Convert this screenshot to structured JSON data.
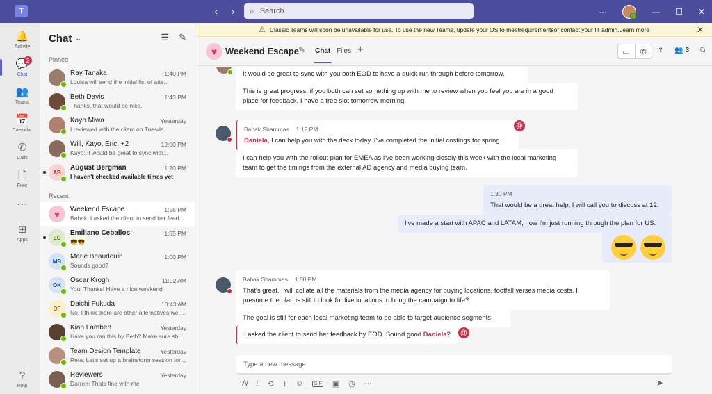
{
  "titlebar": {
    "search_placeholder": "Search",
    "more": "···",
    "minimize": "—",
    "maximize": "☐",
    "close": "✕"
  },
  "rail": {
    "items": [
      {
        "label": "Activity",
        "icon": "bell-icon",
        "glyph": "🔔"
      },
      {
        "label": "Chat",
        "icon": "chat-icon",
        "glyph": "💬",
        "badge": "2"
      },
      {
        "label": "Teams",
        "icon": "teams-icon",
        "glyph": "👥"
      },
      {
        "label": "Calendar",
        "icon": "calendar-icon",
        "glyph": "📅"
      },
      {
        "label": "Calls",
        "icon": "phone-icon",
        "glyph": "✆"
      },
      {
        "label": "Files",
        "icon": "file-icon",
        "glyph": "🗋"
      },
      {
        "label": "Apps",
        "icon": "apps-icon",
        "glyph": "⊞"
      },
      {
        "label": "Help",
        "icon": "help-icon",
        "glyph": "?"
      }
    ],
    "more": "···"
  },
  "chatlist": {
    "title": "Chat",
    "pinned_label": "Pinned",
    "recent_label": "Recent",
    "pinned": [
      {
        "name": "Ray Tanaka",
        "time": "1:40 PM",
        "preview": "Louisa will send the initial list of atte...",
        "avatar_color": "#9b7b6a",
        "initials": ""
      },
      {
        "name": "Beth Davis",
        "time": "1:43 PM",
        "preview": "Thanks, that would be nice.",
        "avatar_color": "#6a4a3a",
        "initials": ""
      },
      {
        "name": "Kayo Miwa",
        "time": "Yesterday",
        "preview": "I reviewed with the client on Tuesda...",
        "avatar_color": "#b08070",
        "initials": ""
      },
      {
        "name": "Will, Kayo, Eric, +2",
        "time": "12:00 PM",
        "preview": "Kayo: It would be great to sync with...",
        "avatar_color": "#8a6a5a",
        "initials": ""
      },
      {
        "name": "August Bergman",
        "time": "1:20 PM",
        "preview": "I haven't checked available times yet",
        "avatar_color": "#f6d5d5",
        "initials": "AB",
        "initials_color": "#a4262c",
        "bold": true
      }
    ],
    "recent": [
      {
        "name": "Weekend Escape",
        "time": "1:58 PM",
        "preview": "Babak: I asked the client to send her feed...",
        "avatar_color": "#f6c7d6",
        "initials": "♥",
        "initials_color": "#e3346c",
        "selected": true,
        "nostatus": true
      },
      {
        "name": "Emiliano Ceballos",
        "time": "1:55 PM",
        "preview": "😎😎",
        "avatar_color": "#dfe8d0",
        "initials": "EC",
        "initials_color": "#498205",
        "bold": true
      },
      {
        "name": "Marie Beaudouin",
        "time": "1:00 PM",
        "preview": "Sounds good?",
        "avatar_color": "#d6e3f4",
        "initials": "MB",
        "initials_color": "#0f548c"
      },
      {
        "name": "Oscar Krogh",
        "time": "11:02 AM",
        "preview": "You: Thanks! Have a nice weekend",
        "avatar_color": "#d6e3f4",
        "initials": "OK",
        "initials_color": "#0f548c"
      },
      {
        "name": "Daichi Fukuda",
        "time": "10:43 AM",
        "preview": "No, I think there are other alternatives we c...",
        "avatar_color": "#fbeecb",
        "initials": "DF",
        "initials_color": "#8a6d00"
      },
      {
        "name": "Kian Lambert",
        "time": "Yesterday",
        "preview": "Have you ran this by Beth? Make sure she is...",
        "avatar_color": "#5a4030",
        "initials": ""
      },
      {
        "name": "Team Design Template",
        "time": "Yesterday",
        "preview": "Reta: Let's set up a brainstorm session for...",
        "avatar_color": "#b89080",
        "initials": ""
      },
      {
        "name": "Reviewers",
        "time": "Yesterday",
        "preview": "Darren: Thats fine with me",
        "avatar_color": "#7a6050",
        "initials": ""
      }
    ]
  },
  "banner": {
    "text_before": "Classic Teams will soon be unavailable for use. To use the new Teams, update your OS to meet ",
    "link1": "requirements",
    "text_middle": " or contact your IT admin. ",
    "link2": "Learn more"
  },
  "chat": {
    "title": "Weekend Escape",
    "tab_chat": "Chat",
    "tab_files": "Files",
    "participants": "3"
  },
  "messages": {
    "m1": "It would be great to sync with you both EOD to have a quick run through before tomorrow.",
    "m2": "This is great progress, if you both can set something up with me to review when you feel you are in a good place for feedback. I have a free slot tomorrow morning.",
    "g2_author": "Babak Shammas",
    "g2_time": "1:12 PM",
    "m3_mention": "Daniela",
    "m3_rest": ", I can help you with the deck today. I've completed the initial costings for spring.",
    "m4": "I can help you with the rollout plan for EMEA as I've been working closely this week with the local marketing team to get the timings from the external AD agency and media buying team.",
    "mine_time": "1:30 PM",
    "m5": "That would be a great help, I will call you to discuss at 12.",
    "m6": "I've made a start with APAC and LATAM, now I'm just running through the plan for US.",
    "g3_author": "Babak Shammas",
    "g3_time": "1:58 PM",
    "m8": "That's great. I will collate all the materials from the media agency for buying locations, footfall verses media costs. I presume the plan is still to look for live locations to bring the campaign to life?",
    "m9": "The goal is still for each local marketing team to be able to target audience segments",
    "m10_before": "I asked the client to send her feedback by EOD. Sound good ",
    "m10_mention": "Daniela",
    "m10_after": "?"
  },
  "compose": {
    "placeholder": "Type a new message"
  },
  "colors": {
    "accent": "#5b5fc7",
    "titlebar": "#4b4e9c",
    "mention": "#c4314b",
    "available": "#6bb700"
  }
}
